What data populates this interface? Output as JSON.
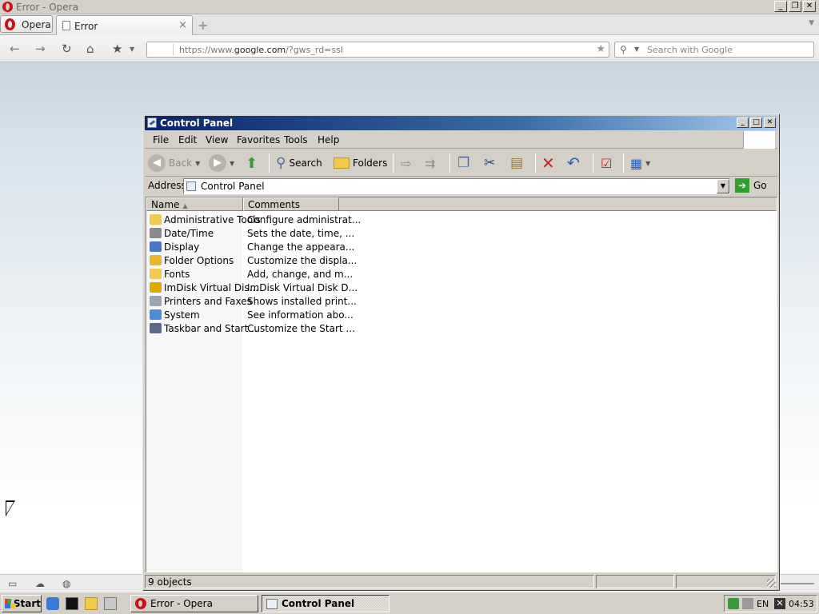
{
  "browser": {
    "window_title": "Error - Opera",
    "menu_label": "Opera",
    "tab": {
      "label": "Error",
      "close": "×"
    },
    "new_tab": "+",
    "url_prefix": "https://www.",
    "url_host": "google.com",
    "url_rest": "/?gws_rd=ssl",
    "search_placeholder": "Search with Google",
    "icons": [
      "back-icon",
      "forward-icon",
      "reload-icon",
      "home-icon",
      "bookmark-star-icon"
    ]
  },
  "control_panel": {
    "title": "Control Panel",
    "menu": [
      "File",
      "Edit",
      "View",
      "Favorites",
      "Tools",
      "Help"
    ],
    "toolbar": {
      "back": "Back",
      "search": "Search",
      "folders": "Folders"
    },
    "address_label": "Address",
    "address_value": "Control Panel",
    "go_label": "Go",
    "columns": {
      "name": "Name",
      "comments": "Comments"
    },
    "items": [
      {
        "name": "Administrative Tools",
        "comment": "Configure administrat...",
        "icon": "folder-tools-icon",
        "color": "#f2c94c"
      },
      {
        "name": "Date/Time",
        "comment": "Sets the date, time, ...",
        "icon": "clock-icon",
        "color": "#8a8a8a"
      },
      {
        "name": "Display",
        "comment": "Change the appeara...",
        "icon": "display-icon",
        "color": "#4a78c8"
      },
      {
        "name": "Folder Options",
        "comment": "Customize the displa...",
        "icon": "folder-options-icon",
        "color": "#e8b830"
      },
      {
        "name": "Fonts",
        "comment": "Add, change, and m...",
        "icon": "fonts-folder-icon",
        "color": "#f2c94c"
      },
      {
        "name": "ImDisk Virtual Dis...",
        "comment": "ImDisk Virtual Disk D...",
        "icon": "disk-icon",
        "color": "#e0a800"
      },
      {
        "name": "Printers and Faxes",
        "comment": "Shows installed print...",
        "icon": "printer-icon",
        "color": "#9aa4ae"
      },
      {
        "name": "System",
        "comment": "See information abo...",
        "icon": "system-icon",
        "color": "#4a90d9"
      },
      {
        "name": "Taskbar and Start...",
        "comment": "Customize the Start ...",
        "icon": "taskbar-icon",
        "color": "#5a6a88"
      }
    ],
    "status_text": "9 objects"
  },
  "taskbar": {
    "start_label": "Start",
    "tasks": [
      {
        "label": "Error - Opera",
        "active": false
      },
      {
        "label": "Control Panel",
        "active": true
      }
    ],
    "language": "EN",
    "clock": "04:53"
  }
}
